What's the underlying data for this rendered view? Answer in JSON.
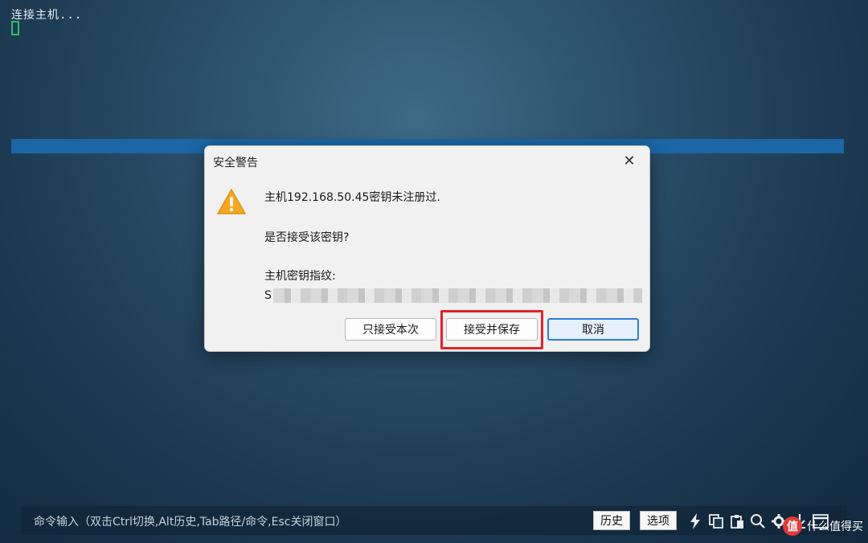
{
  "terminal": {
    "status_line": "连接主机..."
  },
  "dialog": {
    "title": "安全警告",
    "close_glyph": "✕",
    "message_host": "主机192.168.50.45密钥未注册过.",
    "message_question": "是否接受该密钥?",
    "fingerprint_label": "主机密钥指纹:",
    "fingerprint_prefix": "S",
    "buttons": {
      "accept_once": "只接受本次",
      "accept_save": "接受并保存",
      "cancel": "取消"
    },
    "warning_color": "#f5a623"
  },
  "bottom_bar": {
    "command_hint": "命令输入（双击Ctrl切换,Alt历史,Tab路径/命令,Esc关闭窗口）",
    "history_button": "历史",
    "options_button": "选项",
    "icons": [
      "lightning-icon",
      "copy-icon",
      "paste-icon",
      "search-icon",
      "gear-icon",
      "download-icon",
      "window-icon"
    ]
  },
  "watermark": {
    "logo_char": "值",
    "text": "什么值得买"
  },
  "colors": {
    "highlight": "#e3212b",
    "band": "#1b66a6",
    "cursor": "#2fbf5a"
  }
}
